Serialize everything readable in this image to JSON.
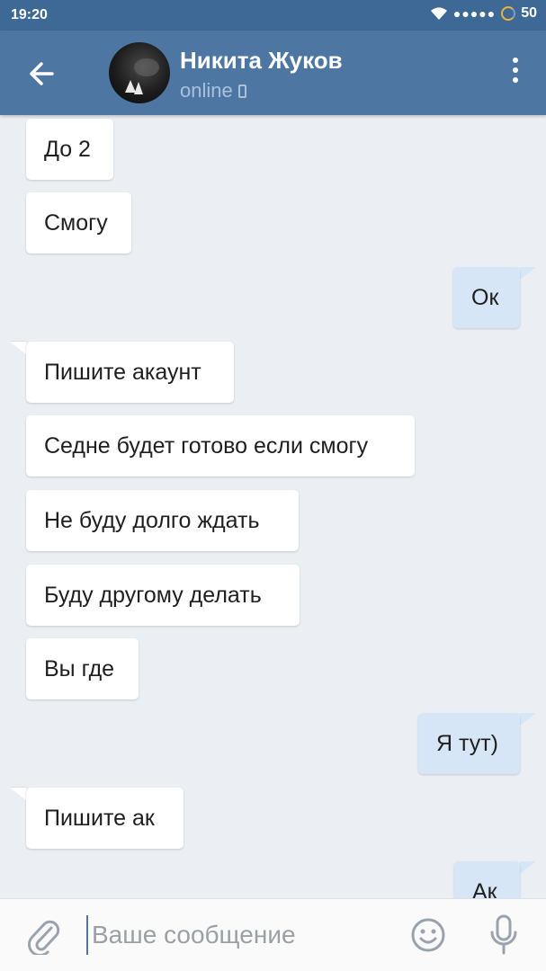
{
  "status_bar": {
    "time": "19:20",
    "signal_dots": "●●●●●",
    "battery": "50"
  },
  "header": {
    "contact_name": "Никита Жуков",
    "status": "online"
  },
  "messages": [
    {
      "direction": "in",
      "text": "До 2"
    },
    {
      "direction": "in",
      "text": "Смогу"
    },
    {
      "direction": "out",
      "text": "Ок"
    },
    {
      "direction": "in",
      "text": "Пишите акаунт"
    },
    {
      "direction": "in",
      "text": "Седне будет готово если смогу"
    },
    {
      "direction": "in",
      "text": "Не буду долго ждать"
    },
    {
      "direction": "in",
      "text": "Буду другому делать"
    },
    {
      "direction": "in",
      "text": "Вы где"
    },
    {
      "direction": "out",
      "text": "Я тут)"
    },
    {
      "direction": "in",
      "text": "Пишите ак"
    },
    {
      "direction": "out",
      "text": "Ак"
    }
  ],
  "composer": {
    "placeholder": "Ваше сообщение"
  },
  "colors": {
    "header_bg": "#4d76a3",
    "status_bg": "#3e6896",
    "chat_bg": "#ebeff4",
    "incoming_bubble": "#ffffff",
    "outgoing_bubble": "#d7e6f6"
  },
  "icons": {
    "back": "arrow-left-icon",
    "menu": "more-vertical-icon",
    "attach": "paperclip-icon",
    "emoji": "smiley-icon",
    "mic": "microphone-icon",
    "wifi": "wifi-icon",
    "battery": "battery-ring-icon"
  }
}
